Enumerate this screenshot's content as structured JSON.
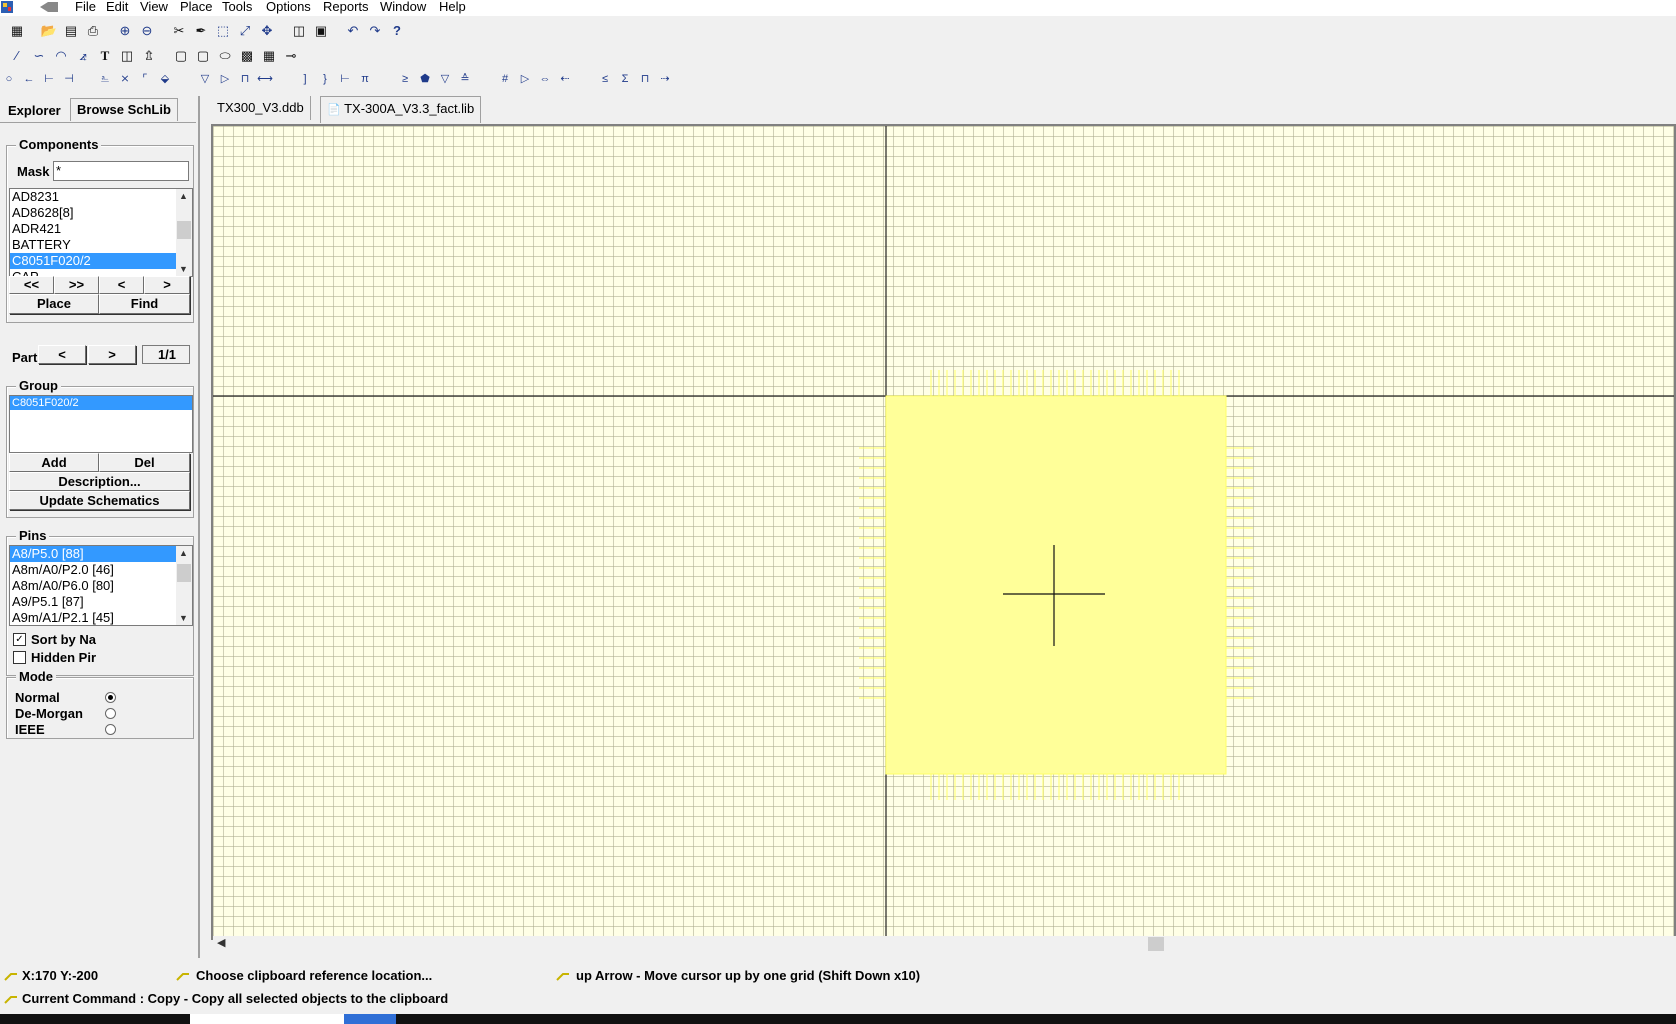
{
  "menu": [
    "File",
    "Edit",
    "View",
    "Place",
    "Tools",
    "Options",
    "Reports",
    "Window",
    "Help"
  ],
  "panel_tabs": {
    "explorer": "Explorer",
    "browse": "Browse SchLib"
  },
  "components": {
    "title": "Components",
    "mask_label": "Mask",
    "mask_value": "*",
    "items": [
      "AD8231",
      "AD8628[8]",
      "ADR421",
      "BATTERY",
      "C8051F020/2",
      "CAP"
    ],
    "selected_index": 4,
    "nav": [
      "<<",
      ">>",
      "<",
      ">"
    ],
    "place": "Place",
    "find": "Find"
  },
  "part": {
    "label": "Part",
    "prev": "<",
    "next": ">",
    "value": "1/1"
  },
  "group": {
    "title": "Group",
    "items": [
      "C8051F020/2"
    ],
    "add": "Add",
    "del": "Del",
    "description": "Description...",
    "update": "Update Schematics"
  },
  "pins": {
    "title": "Pins",
    "items": [
      "A8/P5.0  [88]",
      "A8m/A0/P2.0  [46]",
      "A8m/A0/P6.0  [80]",
      "A9/P5.1  [87]",
      "A9m/A1/P2.1  [45]"
    ],
    "selected_index": 0,
    "sort_label": "Sort by Na",
    "sort_checked": true,
    "hidden_label": "Hidden Pir",
    "hidden_checked": false
  },
  "mode": {
    "title": "Mode",
    "options": [
      "Normal",
      "De-Morgan",
      "IEEE"
    ],
    "selected_index": 0
  },
  "doc_tabs": [
    "TX300_V3.ddb",
    "TX-300A_V3.3_fact.lib"
  ],
  "status": {
    "coords": "X:170 Y:-200",
    "prompt": "Choose clipboard reference location...",
    "hint": "up Arrow - Move cursor up by one grid (Shift Down x10)",
    "command": "Current Command : Copy - Copy all selected objects to the clipboard"
  },
  "colors": {
    "accent": "#3399ff",
    "component_body": "#ffff99",
    "component_outline": "#ffff66",
    "grid_bg": "#ffffe6",
    "icon_blue": "#1f3a8a"
  }
}
